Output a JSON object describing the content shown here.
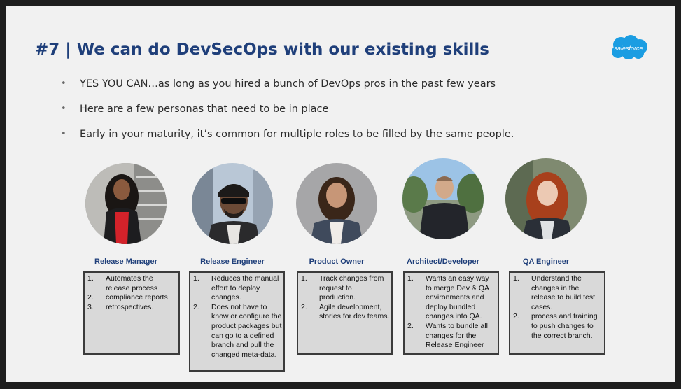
{
  "slide": {
    "title": "#7 | We can do DevSecOps with our existing skills",
    "logo_text": "salesforce",
    "bullets": [
      "YES YOU CAN…as long as you hired a bunch of DevOps pros in the past few years",
      "Here are a few personas that need to be in place",
      "Early in your maturity, it’s common for multiple roles to be filled by the same people."
    ],
    "personas": [
      {
        "role": "Release Manager",
        "items": [
          "Automates the release process",
          "compliance reports",
          "retrospectives."
        ]
      },
      {
        "role": "Release Engineer",
        "items": [
          "Reduces the manual effort to deploy changes.",
          "Does not have to know or configure the product packages but can go to a defined branch and pull the changed meta-data."
        ]
      },
      {
        "role": "Product Owner",
        "items": [
          "Track changes from request to production.",
          "Agile development, stories for dev teams."
        ]
      },
      {
        "role": "Architect/Developer",
        "items": [
          "Wants an easy way to merge Dev & QA environments and deploy bundled changes into QA.",
          "Wants to bundle all changes for the Release Engineer"
        ]
      },
      {
        "role": "QA Engineer",
        "items": [
          "Understand the changes in the release to build test cases.",
          "process and training to push changes to the correct branch."
        ]
      }
    ]
  },
  "colors": {
    "title": "#1f3f7a",
    "logo": "#1b9de2",
    "box_fill": "#d9d9d9"
  },
  "icons": {
    "bullet": "•",
    "logo": "salesforce-cloud-logo"
  }
}
